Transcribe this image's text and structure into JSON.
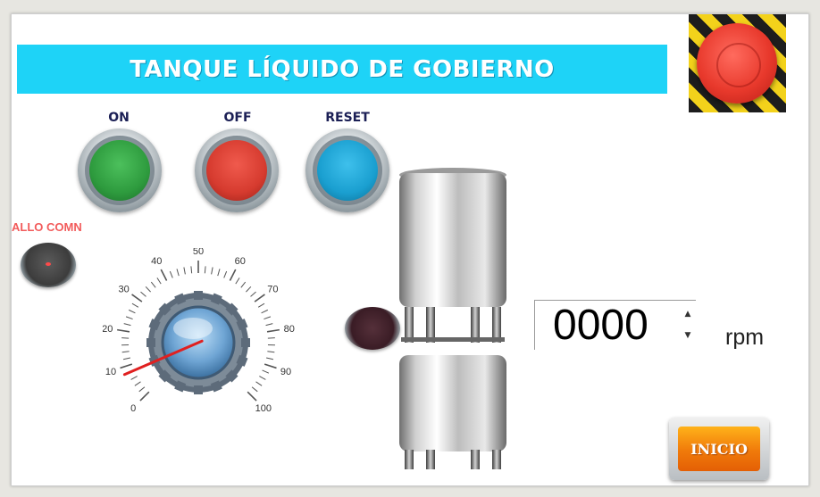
{
  "title": "TANQUE LÍQUIDO DE GOBIERNO",
  "buttons": {
    "on": {
      "label": "ON",
      "color": "#2e9b3e"
    },
    "off": {
      "label": "OFF",
      "color": "#d63b2f"
    },
    "reset": {
      "label": "RESET",
      "color": "#1a9fd0"
    },
    "start": {
      "label": "INICIO"
    },
    "emergency_stop": {
      "icon": "emergency-stop-icon",
      "color": "#e8392c"
    }
  },
  "fault": {
    "label": "ALLO COMN"
  },
  "speed_dial": {
    "min": 0,
    "max": 100,
    "value": 8,
    "ticks": [
      "0",
      "10",
      "20",
      "30",
      "40",
      "50",
      "60",
      "70",
      "80",
      "90",
      "100"
    ]
  },
  "speed_display": {
    "value": "0000",
    "unit": "rpm"
  },
  "colors": {
    "title_bar": "#1ed3f7",
    "fault_label": "#f25b5b",
    "needle": "#e02020"
  }
}
